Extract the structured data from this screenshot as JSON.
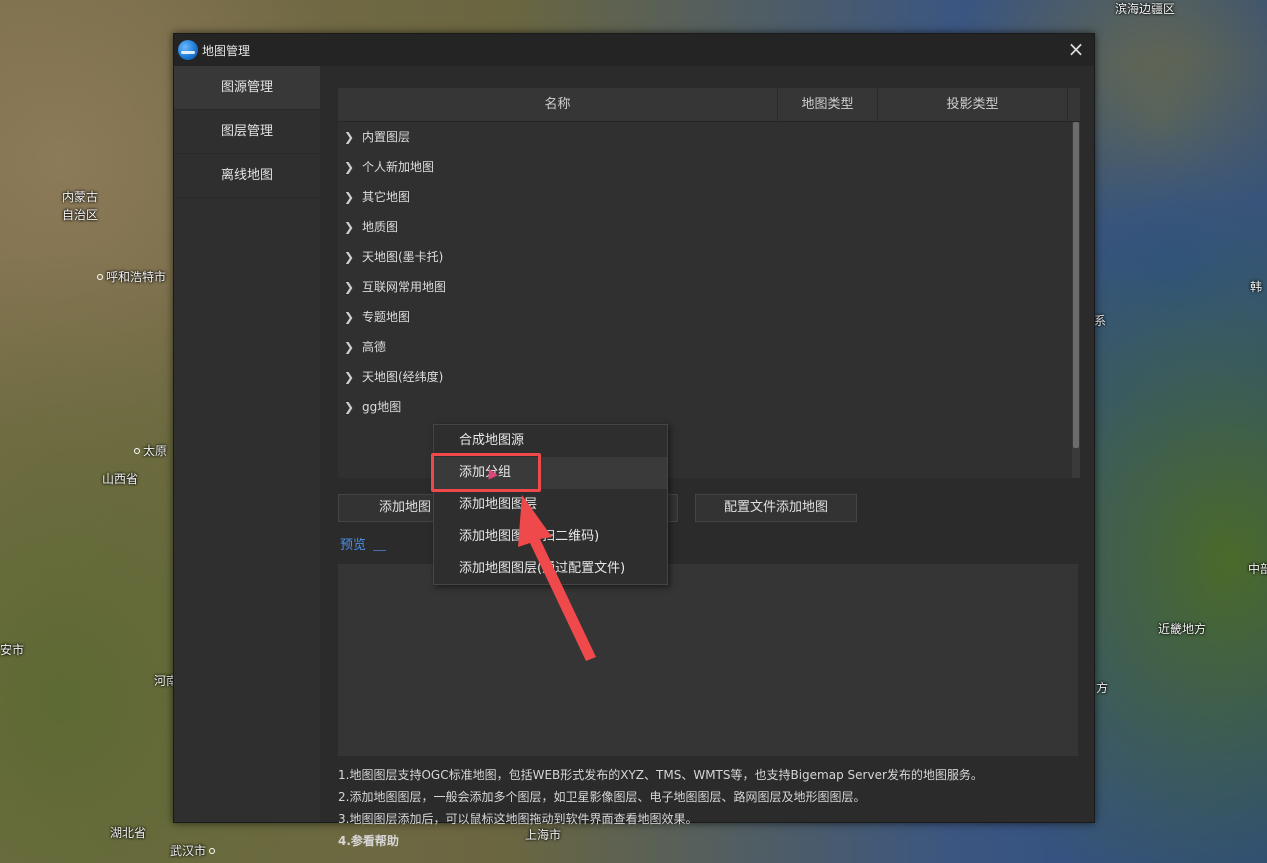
{
  "map": {
    "labels": [
      "滨海边疆区",
      "内蒙古",
      "自治区",
      "呼和浩特市",
      "太原",
      "山西省",
      "河南",
      "湖北省",
      "武汉市",
      "上海市",
      "近畿地方",
      "中部",
      "安市",
      "方",
      "韩",
      "系"
    ]
  },
  "window": {
    "title": "地图管理",
    "close_icon": "×"
  },
  "sidebar": {
    "items": [
      {
        "label": "图源管理"
      },
      {
        "label": "图层管理"
      },
      {
        "label": "离线地图"
      }
    ]
  },
  "table": {
    "columns": [
      "名称",
      "地图类型",
      "投影类型"
    ],
    "rows": [
      {
        "label": "内置图层"
      },
      {
        "label": "个人新加地图"
      },
      {
        "label": "其它地图"
      },
      {
        "label": "地质图"
      },
      {
        "label": "天地图(墨卡托)"
      },
      {
        "label": "互联网常用地图"
      },
      {
        "label": "专题地图"
      },
      {
        "label": "高德"
      },
      {
        "label": "天地图(经纬度)"
      },
      {
        "label": "gg地图"
      }
    ]
  },
  "buttons": {
    "add_map_label": "添加地图",
    "config_add_label": "配置文件添加地图"
  },
  "preview": {
    "label": "预览"
  },
  "help": {
    "line1": "1.地图图层支持OGC标准地图，包括WEB形式发布的XYZ、TMS、WMTS等，也支持Bigemap Server发布的地图服务。",
    "line2": "2.添加地图图层，一般会添加多个图层，如卫星影像图层、电子地图图层、路网图层及地形图图层。",
    "line3": "3.地图图层添加后，可以鼠标这地图拖动到软件界面查看地图效果。",
    "line4": "4.参看帮助"
  },
  "context_menu": {
    "items": [
      {
        "label": "合成地图源"
      },
      {
        "label": "添加分组"
      },
      {
        "label": "添加地图图层"
      },
      {
        "label": "添加地图图层(扫二维码)"
      },
      {
        "label": "添加地图图层(通过配置文件)"
      }
    ]
  },
  "colors": {
    "highlight": "#f0494c",
    "link": "#4d8fe6"
  }
}
